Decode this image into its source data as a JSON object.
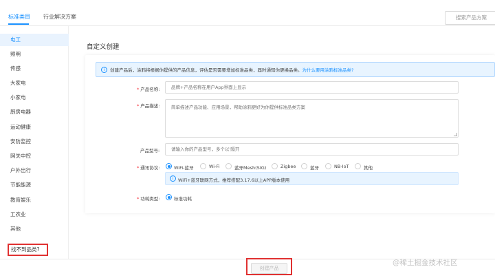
{
  "tabs": [
    {
      "label": "标准类目"
    },
    {
      "label": "行业解决方案"
    }
  ],
  "search": {
    "label": "搜索产品方案"
  },
  "sidebar": {
    "categories": [
      "电工",
      "照明",
      "传感",
      "大家电",
      "小家电",
      "厨房电器",
      "运动健康",
      "安防监控",
      "网关中控",
      "户外出行",
      "节能能源",
      "教育娱乐",
      "工农业",
      "其他"
    ],
    "not_found": "找不到品类?"
  },
  "page_title": "自定义创建",
  "notice": {
    "icon": "info-icon",
    "text": "创建产品后，涂鸦将根据你提供的产品信息，评估是否需要增加标准品类，届时通知你更换品类。",
    "link": "为什么要用涂鸦标准品类?"
  },
  "form": {
    "name_label": "产品名称:",
    "name_placeholder": "品牌+产品名称在用户App界面上显示",
    "desc_label": "产品描述:",
    "desc_placeholder": "简单描述产品功能、应用场景，帮助涂鸦更好为你提供标准品类方案",
    "model_label": "产品型号:",
    "model_placeholder": "请输入你的产品型号，多个以'隔开",
    "protocol_label": "通讯协议:",
    "protocols": [
      "WiFi-蓝牙",
      "Wi-Fi",
      "蓝牙Mesh(SIG)",
      "Zigbee",
      "蓝牙",
      "NB-IoT",
      "其他"
    ],
    "protocol_selected": "WiFi-蓝牙",
    "protocol_hint": "WiFi+蓝牙联网方式，推荐搭配3.17.6以上APP版本使用",
    "power_label": "功耗类型:",
    "power_option": "标准功耗"
  },
  "footer": {
    "create_label": "创建产品"
  },
  "watermark": "@稀土掘金技术社区",
  "colors": {
    "accent": "#1890ff",
    "highlight_red": "#e03131",
    "notice_bg": "#e8f4ff"
  }
}
